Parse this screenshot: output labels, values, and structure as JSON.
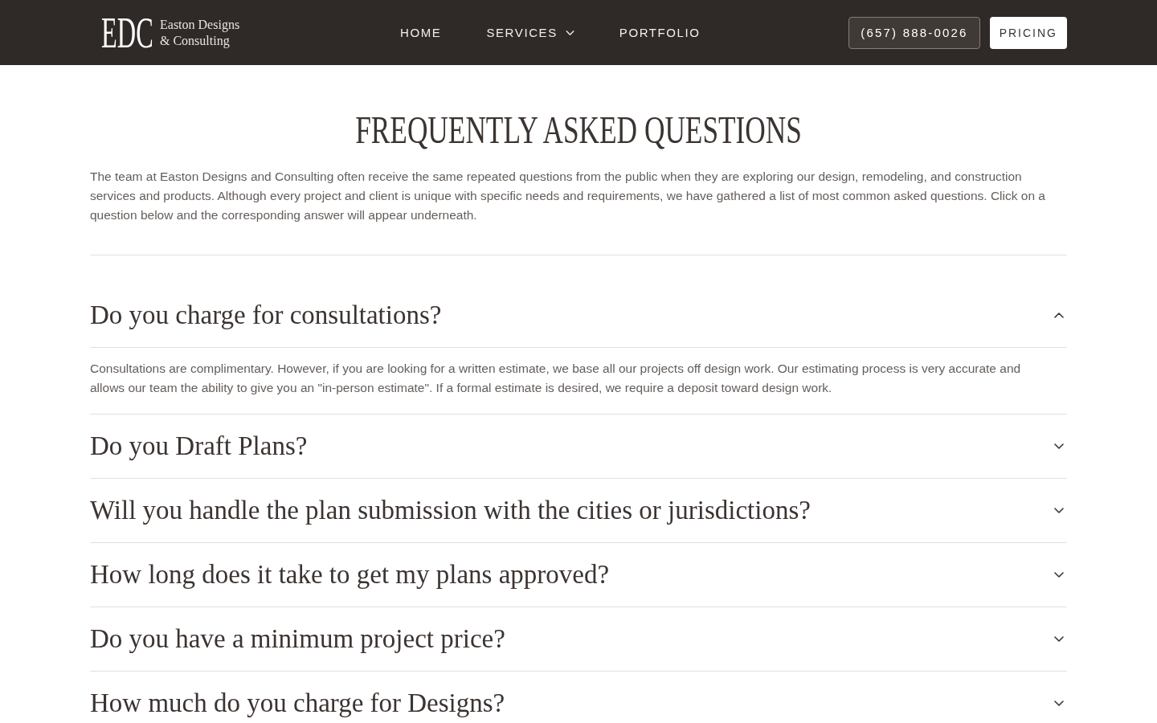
{
  "header": {
    "logo": {
      "monogram": "EDC",
      "line_1": "Easton Designs",
      "line_2": "& Consulting"
    },
    "nav": [
      {
        "label": "HOME",
        "has_dropdown": false
      },
      {
        "label": "SERVICES",
        "has_dropdown": true
      },
      {
        "label": "PORTFOLIO",
        "has_dropdown": false
      }
    ],
    "phone_button": "(657) 888-0026",
    "pricing_button": "PRICING"
  },
  "faq": {
    "title": "FREQUENTLY ASKED QUESTIONS",
    "intro": "The team at Easton Designs and Consulting often receive the same repeated questions from the public when they are exploring our design, remodeling, and construction services and products. Although every project and client is unique with specific needs and requirements, we have gathered a list of most common asked questions. Click on a question below and the corresponding answer will appear underneath.",
    "items": [
      {
        "question": "Do you charge for consultations?",
        "expanded": true,
        "answer": "Consultations are complimentary. However, if you are looking for a written estimate, we base all our projects off design work. Our estimating process is very accurate and allows our team the ability to give you an \"in-person estimate\". If a formal estimate is desired, we require a deposit toward design work."
      },
      {
        "question": "Do you Draft Plans?",
        "expanded": false
      },
      {
        "question": "Will you handle the plan submission with the cities or jurisdictions?",
        "expanded": false
      },
      {
        "question": "How long does it take to get my plans approved?",
        "expanded": false
      },
      {
        "question": "Do you have a minimum project price?",
        "expanded": false
      },
      {
        "question": "How much do you charge for Designs?",
        "expanded": false
      }
    ]
  }
}
